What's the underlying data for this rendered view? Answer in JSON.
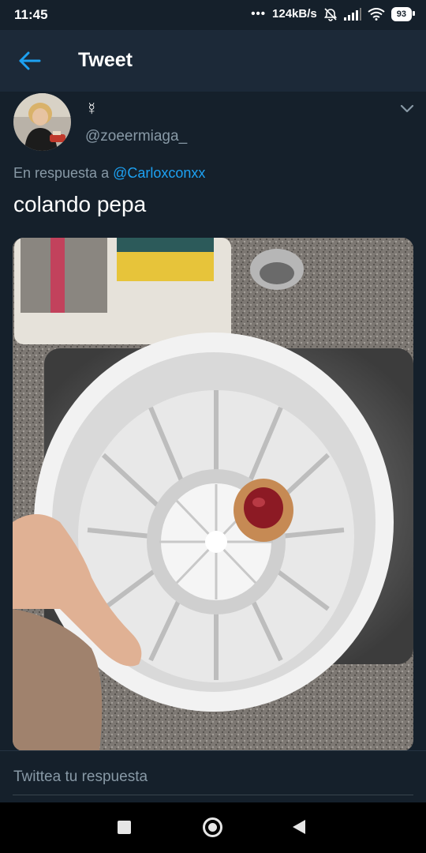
{
  "status_bar": {
    "time": "11:45",
    "dots": "•••",
    "network_speed": "124kB/s",
    "battery": "93",
    "icons": [
      "alarm-off-icon",
      "signal-icon",
      "wifi-icon",
      "battery-icon"
    ]
  },
  "header": {
    "back_icon": "arrow-left-icon",
    "title": "Tweet"
  },
  "tweet": {
    "display_name": "☿",
    "username": "@zoeermiaga_",
    "reply_prefix": "En respuesta a ",
    "reply_mention": "@Carloxconxx",
    "text": "colando pepa",
    "menu_icon": "chevron-down-icon",
    "media_icon": "photo"
  },
  "reply": {
    "placeholder": "Twittea tu respuesta"
  },
  "nav": {
    "icons": [
      "recents-square-icon",
      "home-circle-icon",
      "back-triangle-icon"
    ]
  },
  "colors": {
    "background": "#15202b",
    "header": "#1c2938",
    "accent": "#1da1f2",
    "secondary_text": "#8899a6"
  }
}
